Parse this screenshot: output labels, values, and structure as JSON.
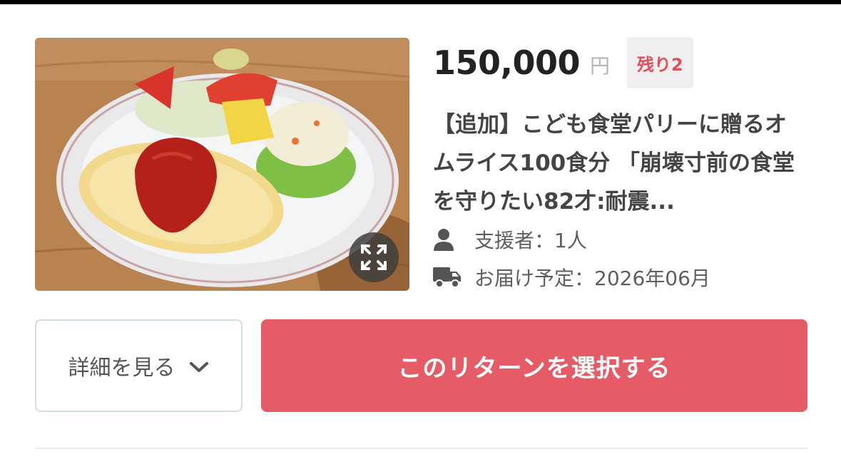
{
  "reward": {
    "price": "150,000",
    "currency": "円",
    "remaining_badge": "残り2",
    "title": "【追加】こども食堂パリーに贈るオムライス100食分 「崩壊寸前の食堂を守りたい82才:耐震...",
    "supporters": "支援者：1人",
    "delivery": "お届け予定：2026年06月",
    "image_icon": "expand-icon",
    "supporters_icon": "person-icon",
    "delivery_icon": "truck-icon"
  },
  "actions": {
    "details_label": "詳細を見る",
    "details_icon": "chevron-down-icon",
    "select_label": "このリターンを選択する"
  },
  "colors": {
    "accent": "#e65c66",
    "remaining_text": "#e0505c",
    "price_text": "#222222",
    "title_text": "#444444"
  }
}
